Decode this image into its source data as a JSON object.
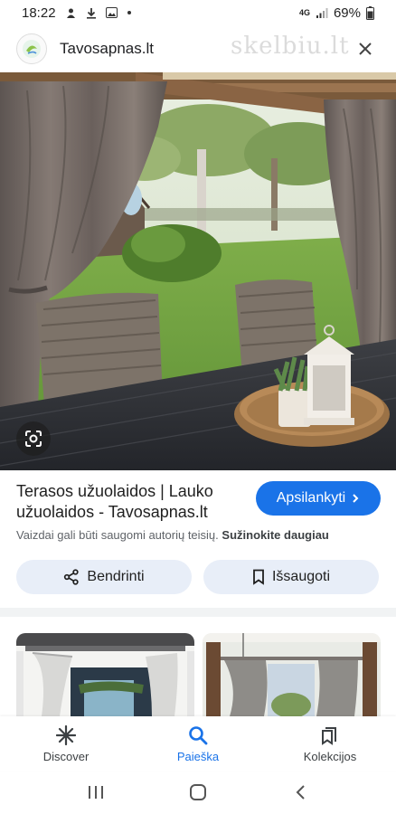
{
  "status_bar": {
    "time": "18:22",
    "network": "4G",
    "battery": "69%"
  },
  "header": {
    "site_name": "Tavosapnas.lt",
    "watermark": "skelbiu.lt",
    "icons": [
      "site-logo",
      "close-icon"
    ]
  },
  "result": {
    "title": "Terasos užuolaidos | Lauko užuolaidos - Tavosapnas.lt",
    "visit_label": "Apsilankyti",
    "disclaimer": "Vaizdai gali būti saugomi autorių teisių.",
    "disclaimer_link": "Sužinokite daugiau"
  },
  "actions": {
    "share_label": "Bendrinti",
    "save_label": "Išsaugoti"
  },
  "bottom_nav": {
    "items": [
      {
        "label": "Discover",
        "icon": "asterisk-icon",
        "active": false
      },
      {
        "label": "Paieška",
        "icon": "search-icon",
        "active": true
      },
      {
        "label": "Kolekcijos",
        "icon": "collections-icon",
        "active": false
      }
    ]
  },
  "colors": {
    "accent": "#1a73e8",
    "chip_bg": "#e8eef8"
  }
}
